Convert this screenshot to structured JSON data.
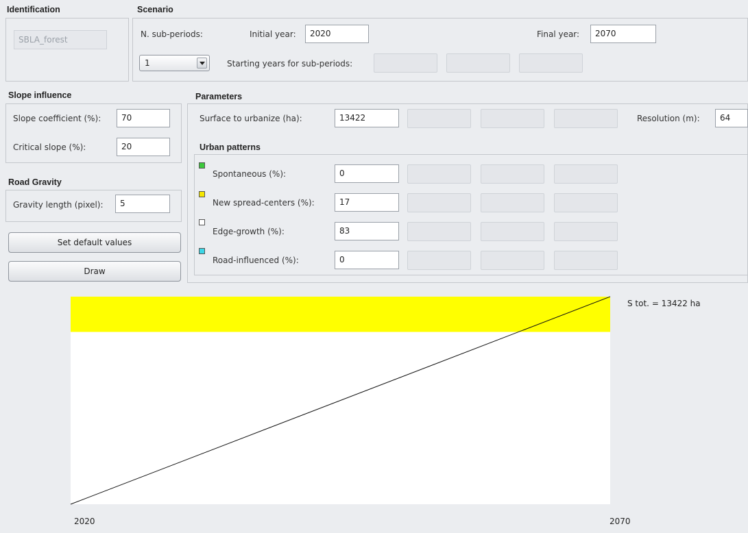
{
  "identification": {
    "title": "Identification",
    "name_value": "SBLA_forest"
  },
  "scenario": {
    "title": "Scenario",
    "n_subperiods_label": "N. sub-periods:",
    "n_subperiods_value": "1",
    "initial_year_label": "Initial year:",
    "initial_year_value": "2020",
    "final_year_label": "Final year:",
    "final_year_value": "2070",
    "starting_years_label": "Starting years for sub-periods:"
  },
  "slope": {
    "title": "Slope influence",
    "coef_label": "Slope coefficient (%):",
    "coef_value": "70",
    "critical_label": "Critical slope (%):",
    "critical_value": "20"
  },
  "road": {
    "title": "Road Gravity",
    "gravity_label": "Gravity length (pixel):",
    "gravity_value": "5"
  },
  "buttons": {
    "defaults": "Set default values",
    "draw": "Draw"
  },
  "parameters": {
    "title": "Parameters",
    "surface_label": "Surface to urbanize (ha):",
    "surface_value": "13422",
    "resolution_label": "Resolution (m):",
    "resolution_value": "64"
  },
  "patterns": {
    "title": "Urban patterns",
    "items": [
      {
        "label": "Spontaneous (%):",
        "value": "0",
        "color": "#3cc83c"
      },
      {
        "label": "New spread-centers (%):",
        "value": "17",
        "color": "#f5e600"
      },
      {
        "label": "Edge-growth (%):",
        "value": "83",
        "color": "#ffffff"
      },
      {
        "label": "Road-influenced (%):",
        "value": "0",
        "color": "#3cd6e6"
      }
    ]
  },
  "chart_data": {
    "type": "area",
    "x": [
      2020,
      2070
    ],
    "total_label": "S tot. = 13422 ha",
    "xtick_labels": [
      "2020",
      "2070"
    ],
    "cumulative_line": [
      0,
      13422
    ],
    "bands_top_to_bottom": [
      {
        "name": "New spread-centers",
        "share_percent": 17,
        "color": "#ffff00"
      },
      {
        "name": "Edge-growth",
        "share_percent": 83,
        "color": "#ffffff"
      }
    ]
  }
}
